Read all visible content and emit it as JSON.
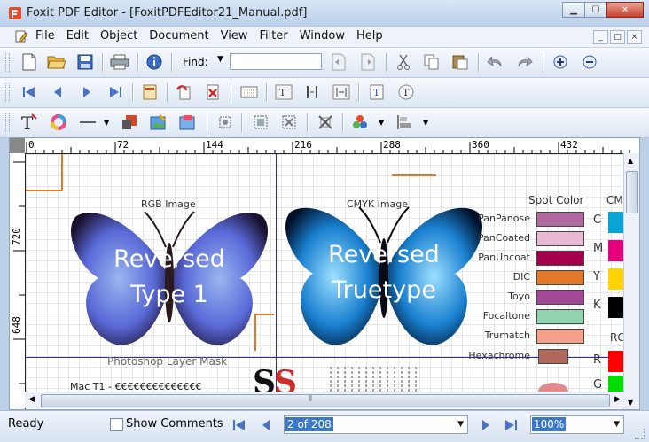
{
  "window": {
    "title": "Foxit PDF Editor - [FoxitPDFEditor21_Manual.pdf]",
    "minimize": "▁",
    "maximize": "☐",
    "close": "✕"
  },
  "menubar": {
    "items": [
      "File",
      "Edit",
      "Object",
      "Document",
      "View",
      "Filter",
      "Window",
      "Help"
    ],
    "mdi": [
      "_",
      "□",
      "×"
    ]
  },
  "toolbar": {
    "find_label": "Find:",
    "find_value": ""
  },
  "ruler": {
    "h_labels": [
      "0",
      "72",
      "144",
      "216",
      "288",
      "360",
      "432"
    ],
    "v_labels": [
      "720",
      "648"
    ]
  },
  "document": {
    "rgb_label": "RGB Image",
    "cmyk_label": "CMYK Image",
    "reversed_type1": [
      "Reversed",
      "Type 1"
    ],
    "reversed_truetype": [
      "Reversed",
      "Truetype"
    ],
    "photoshop_label": "Photoshop Layer Mask",
    "mac_t1": "Mac T1 - €€€€€€€€€€€€€€",
    "spot_heading": "Spot Color",
    "cmyk_heading": "CM",
    "rgb_heading": "RG",
    "spot_colors": [
      {
        "label": "PanPanose",
        "color": "#b06aa0"
      },
      {
        "label": "PanCoated",
        "color": "#e8b9d2"
      },
      {
        "label": "PanUncoat",
        "color": "#a3004d"
      },
      {
        "label": "DIC",
        "color": "#e07a2a"
      },
      {
        "label": "Toyo",
        "color": "#a04a96"
      },
      {
        "label": "Focaltone",
        "color": "#8fd3b0"
      },
      {
        "label": "Trumatch",
        "color": "#f4a08a"
      },
      {
        "label": "Hexachrome",
        "color": "#b0685a"
      }
    ],
    "cmyk_swatches": [
      {
        "label": "C",
        "color": "#0aa4d4"
      },
      {
        "label": "M",
        "color": "#e6007e"
      },
      {
        "label": "Y",
        "color": "#ffd400"
      },
      {
        "label": "K",
        "color": "#000000"
      }
    ],
    "rgb_swatches": [
      {
        "label": "R",
        "color": "#ff0000"
      },
      {
        "label": "G",
        "color": "#00dd00"
      }
    ]
  },
  "statusbar": {
    "ready": "Ready",
    "show_comments": "Show Comments",
    "page": "2 of 208",
    "zoom": "100%"
  },
  "colors": {
    "guide": "#2a2aa8",
    "marker": "#e07a2a"
  }
}
